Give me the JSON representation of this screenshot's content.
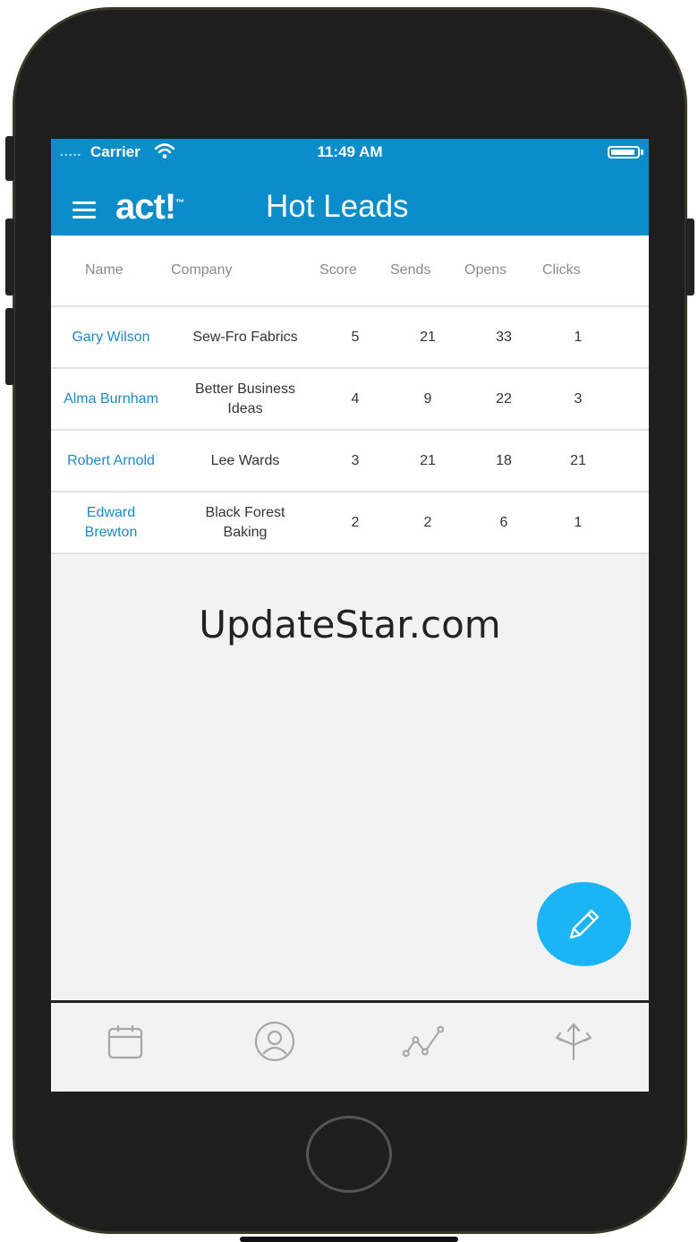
{
  "status_bar": {
    "signal_dots": ".....",
    "carrier": "Carrier",
    "time": "11:49 AM"
  },
  "header": {
    "logo": "act!",
    "title": "Hot Leads"
  },
  "table": {
    "columns": [
      "Name",
      "Company",
      "Score",
      "Sends",
      "Opens",
      "Clicks"
    ],
    "rows": [
      {
        "name": "Gary Wilson",
        "company": "Sew-Fro Fabrics",
        "score": "5",
        "sends": "21",
        "opens": "33",
        "clicks": "1"
      },
      {
        "name": "Alma Burnham",
        "company": "Better Business Ideas",
        "score": "4",
        "sends": "9",
        "opens": "22",
        "clicks": "3"
      },
      {
        "name": "Robert Arnold",
        "company": "Lee Wards",
        "score": "3",
        "sends": "21",
        "opens": "18",
        "clicks": "21"
      },
      {
        "name": "Edward Brewton",
        "company": "Black Forest Baking",
        "score": "2",
        "sends": "2",
        "opens": "6",
        "clicks": "1"
      }
    ]
  },
  "watermark": "UpdateStar.com",
  "colors": {
    "header_bg": "#0b8dc9",
    "name_link": "#1a8bc8",
    "fab": "#1bb4f5"
  },
  "icons": {
    "fab": "pencil-icon",
    "tabs": [
      "calendar-icon",
      "contact-icon",
      "analytics-icon",
      "directions-icon"
    ]
  }
}
